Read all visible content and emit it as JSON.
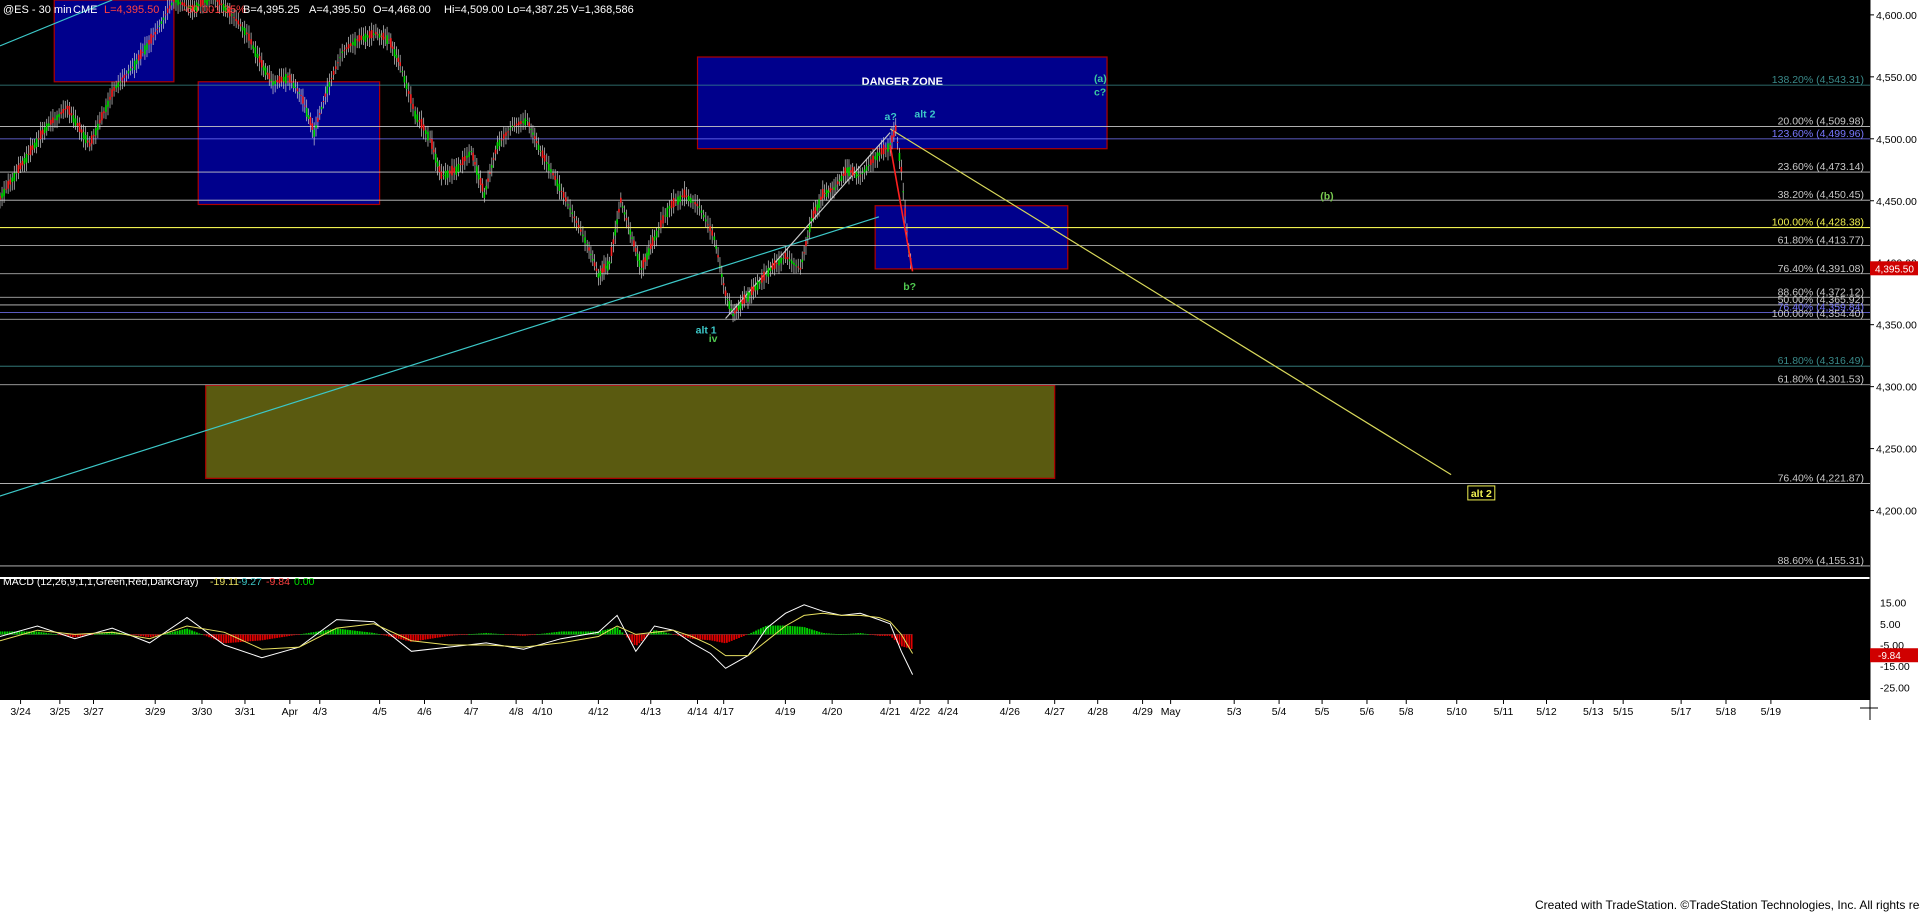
{
  "chart_data": [
    {
      "type": "candlestick",
      "header": {
        "symbol": "@ES - 30 min",
        "exchange": "CME",
        "last": "L=4,395.50",
        "change": "-60.00",
        "change_pct": "-1.35%",
        "bid": "B=4,395.25",
        "ask": "A=4,395.50",
        "open": "O=4,468.00",
        "high": "Hi=4,509.00",
        "low": "Lo=4,387.25",
        "volume": "V=1,368,586"
      },
      "y_axis": {
        "ylim": [
          4148,
          4612
        ],
        "ticks": [
          "4,600.00",
          "4,550.00",
          "4,500.00",
          "4,450.00",
          "4,400.00",
          "4,350.00",
          "4,300.00",
          "4,250.00",
          "4,200.00"
        ],
        "tick_values": [
          4600,
          4550,
          4500,
          4450,
          4400,
          4350,
          4300,
          4250,
          4200
        ],
        "last_price_label": "4,395.50",
        "last_price_value": 4395.5
      },
      "x_axis": {
        "tick_labels": [
          "3/24",
          "3/25",
          "3/27",
          "3/29",
          "3/30",
          "3/31",
          "Apr",
          "4/3",
          "4/5",
          "4/6",
          "4/7",
          "4/8",
          "4/10",
          "4/12",
          "4/13",
          "4/14",
          "4/17",
          "4/19",
          "4/20",
          "4/21",
          "4/22",
          "4/24",
          "4/26",
          "4/27",
          "4/28",
          "4/29",
          "May",
          "5/3",
          "5/4",
          "5/5",
          "5/6",
          "5/8",
          "5/10",
          "5/11",
          "5/12",
          "5/13",
          "5/15",
          "5/17",
          "5/18",
          "5/19"
        ],
        "index_range": [
          0,
          100
        ],
        "tick_positions": [
          1.1,
          3.2,
          5.0,
          8.3,
          10.8,
          13.1,
          15.5,
          17.1,
          20.3,
          22.7,
          25.2,
          27.6,
          29.0,
          32.0,
          34.8,
          37.3,
          38.7,
          42.0,
          44.5,
          47.6,
          49.2,
          50.7,
          54.0,
          56.4,
          58.7,
          61.1,
          62.6,
          66.0,
          68.4,
          70.7,
          73.1,
          75.2,
          77.9,
          80.4,
          82.7,
          85.2,
          86.8,
          89.9,
          92.3,
          94.7
        ]
      },
      "price_path": [
        [
          0.0,
          4452
        ],
        [
          1.2,
          4480
        ],
        [
          2.5,
          4510
        ],
        [
          3.6,
          4525
        ],
        [
          4.8,
          4495
        ],
        [
          6.1,
          4540
        ],
        [
          7.2,
          4560
        ],
        [
          8.3,
          4585
        ],
        [
          9.3,
          4612
        ],
        [
          10.3,
          4605
        ],
        [
          11.4,
          4615
        ],
        [
          12.4,
          4600
        ],
        [
          13.2,
          4585
        ],
        [
          14.0,
          4560
        ],
        [
          14.6,
          4545
        ],
        [
          15.4,
          4550
        ],
        [
          16.1,
          4535
        ],
        [
          16.8,
          4505
        ],
        [
          17.5,
          4540
        ],
        [
          18.3,
          4570
        ],
        [
          19.1,
          4580
        ],
        [
          20.1,
          4585
        ],
        [
          20.8,
          4580
        ],
        [
          21.4,
          4560
        ],
        [
          22.2,
          4520
        ],
        [
          23.0,
          4500
        ],
        [
          23.6,
          4470
        ],
        [
          24.4,
          4475
        ],
        [
          25.2,
          4490
        ],
        [
          25.9,
          4455
        ],
        [
          26.6,
          4495
        ],
        [
          27.4,
          4510
        ],
        [
          28.2,
          4515
        ],
        [
          28.9,
          4490
        ],
        [
          29.8,
          4465
        ],
        [
          30.6,
          4440
        ],
        [
          31.4,
          4415
        ],
        [
          32.0,
          4390
        ],
        [
          32.6,
          4400
        ],
        [
          33.2,
          4450
        ],
        [
          33.8,
          4420
        ],
        [
          34.3,
          4395
        ],
        [
          35.0,
          4420
        ],
        [
          35.8,
          4445
        ],
        [
          36.6,
          4455
        ],
        [
          37.4,
          4445
        ],
        [
          38.2,
          4420
        ],
        [
          38.8,
          4375
        ],
        [
          39.2,
          4358
        ],
        [
          39.8,
          4370
        ],
        [
          40.4,
          4380
        ],
        [
          41.2,
          4395
        ],
        [
          42.0,
          4405
        ],
        [
          42.8,
          4395
        ],
        [
          43.4,
          4435
        ],
        [
          44.0,
          4455
        ],
        [
          44.6,
          4460
        ],
        [
          45.3,
          4475
        ],
        [
          46.0,
          4470
        ],
        [
          46.8,
          4485
        ],
        [
          47.6,
          4495
        ],
        [
          47.9,
          4508
        ],
        [
          48.2,
          4475
        ],
        [
          48.4,
          4440
        ],
        [
          48.6,
          4410
        ],
        [
          48.8,
          4393
        ]
      ],
      "macd": {
        "label": "MACD (12,26,9,1,1,Green,Red,DarkGray)",
        "values_text": [
          "-19.11",
          "-9.27",
          "-9.84",
          "0.00"
        ],
        "ylim": [
          -31,
          21
        ],
        "ticks": [
          "15.00",
          "5.00",
          "-5.00",
          "-15.00",
          "-25.00"
        ],
        "tick_values": [
          15,
          5,
          -5,
          -15,
          -25
        ],
        "last_label": "-9.84",
        "last_value": -9.84,
        "macd_line": [
          [
            0,
            -1
          ],
          [
            2,
            4
          ],
          [
            4,
            -2
          ],
          [
            6,
            3
          ],
          [
            8,
            -4
          ],
          [
            10,
            8
          ],
          [
            12,
            -5
          ],
          [
            14,
            -11
          ],
          [
            16,
            -6
          ],
          [
            18,
            7
          ],
          [
            20,
            6
          ],
          [
            22,
            -8
          ],
          [
            24,
            -6
          ],
          [
            26,
            -4
          ],
          [
            28,
            -7
          ],
          [
            30,
            -2
          ],
          [
            32,
            1
          ],
          [
            33,
            9
          ],
          [
            34,
            -8
          ],
          [
            35,
            4
          ],
          [
            36,
            2
          ],
          [
            37,
            -4
          ],
          [
            38,
            -9
          ],
          [
            38.8,
            -16
          ],
          [
            40,
            -10
          ],
          [
            41,
            3
          ],
          [
            42,
            10
          ],
          [
            43,
            14
          ],
          [
            44,
            11
          ],
          [
            45,
            9
          ],
          [
            46,
            10
          ],
          [
            47,
            7
          ],
          [
            47.6,
            5
          ],
          [
            48.2,
            -8
          ],
          [
            48.8,
            -19
          ]
        ],
        "signal_line": [
          [
            0,
            -3
          ],
          [
            2,
            2
          ],
          [
            4,
            0
          ],
          [
            6,
            1
          ],
          [
            8,
            -2
          ],
          [
            10,
            4
          ],
          [
            12,
            1
          ],
          [
            14,
            -7
          ],
          [
            16,
            -6
          ],
          [
            18,
            3
          ],
          [
            20,
            5
          ],
          [
            22,
            -3
          ],
          [
            24,
            -5
          ],
          [
            26,
            -5
          ],
          [
            28,
            -6
          ],
          [
            30,
            -4
          ],
          [
            32,
            -1
          ],
          [
            33,
            4
          ],
          [
            34,
            0
          ],
          [
            35,
            1
          ],
          [
            36,
            2
          ],
          [
            37,
            -1
          ],
          [
            38,
            -5
          ],
          [
            38.8,
            -10
          ],
          [
            40,
            -10
          ],
          [
            41,
            -3
          ],
          [
            42,
            4
          ],
          [
            43,
            9
          ],
          [
            44,
            10
          ],
          [
            45,
            9
          ],
          [
            46,
            9
          ],
          [
            47,
            8
          ],
          [
            47.6,
            6
          ],
          [
            48.2,
            0
          ],
          [
            48.8,
            -9
          ]
        ]
      },
      "fib_levels": [
        {
          "label": "138.20% (4,543.31)",
          "value": 4543.31,
          "color": "#3a8a8a"
        },
        {
          "label": "20.00% (4,509.98)",
          "value": 4509.98,
          "color": "#c8c8c8"
        },
        {
          "label": "123.60% (4,499.96)",
          "value": 4499.96,
          "color": "#7878ff"
        },
        {
          "label": "23.60% (4,473.14)",
          "value": 4473.14,
          "color": "#c8c8c8"
        },
        {
          "label": "38.20% (4,450.45)",
          "value": 4450.45,
          "color": "#c8c8c8"
        },
        {
          "label": "100.00% (4,428.38)",
          "value": 4428.38,
          "color": "#f0f050"
        },
        {
          "label": "61.80% (4,413.77)",
          "value": 4413.77,
          "color": "#c8c8c8"
        },
        {
          "label": "76.40% (4,391.08)",
          "value": 4391.08,
          "color": "#c8c8c8"
        },
        {
          "label": "88.60% (4,372.12)",
          "value": 4372.12,
          "color": "#c8c8c8"
        },
        {
          "label": "50.00% (4,365.92)",
          "value": 4365.92,
          "color": "#c8c8c8"
        },
        {
          "label": "76.40% (4,359.84)",
          "value": 4359.84,
          "color": "#7878ff"
        },
        {
          "label": "100.00% (4,354.40)",
          "value": 4354.4,
          "color": "#c8c8c8"
        },
        {
          "label": "61.80% (4,316.49)",
          "value": 4316.49,
          "color": "#3a8a8a"
        },
        {
          "label": "61.80% (4,301.53)",
          "value": 4301.53,
          "color": "#c8c8c8"
        },
        {
          "label": "76.40% (4,221.87)",
          "value": 4221.87,
          "color": "#c8c8c8"
        },
        {
          "label": "88.60% (4,155.31)",
          "value": 4155.31,
          "color": "#c8c8c8"
        }
      ],
      "zones": [
        {
          "name": "",
          "x0": 2.9,
          "x1": 9.3,
          "y0": 4546,
          "y1": 4612,
          "fill": "#00008c",
          "stroke": "#b00000"
        },
        {
          "name": "",
          "x0": 10.6,
          "x1": 20.3,
          "y0": 4447,
          "y1": 4546,
          "fill": "#00008c",
          "stroke": "#b00000"
        },
        {
          "name": "DANGER ZONE",
          "x0": 37.3,
          "x1": 59.2,
          "y0": 4492,
          "y1": 4566,
          "fill": "#00008c",
          "stroke": "#b00000"
        },
        {
          "name": "",
          "x0": 46.8,
          "x1": 57.1,
          "y0": 4395,
          "y1": 4446,
          "fill": "#00008c",
          "stroke": "#b00000"
        },
        {
          "name": "",
          "x0": 11.0,
          "x1": 56.4,
          "y0": 4226,
          "y1": 4301,
          "fill": "#5a5a10",
          "stroke": "#b00000"
        }
      ],
      "trendlines": [
        {
          "from": [
            -1,
            4207
          ],
          "to": [
            47.0,
            4437
          ],
          "color": "#3cc8c8"
        },
        {
          "from": [
            0,
            4575
          ],
          "to": [
            6.0,
            4612
          ],
          "color": "#3cc8c8"
        },
        {
          "from": [
            38.8,
            4355
          ],
          "to": [
            47.6,
            4505
          ],
          "color": "#c8c8c8"
        },
        {
          "from": [
            47.6,
            4508
          ],
          "to": [
            77.6,
            4229
          ],
          "color": "#d8d85a"
        }
      ],
      "annotations": [
        {
          "text": "a?",
          "x": 47.3,
          "y": 4515,
          "color": "#3cc8c8"
        },
        {
          "text": "alt 2",
          "x": 48.9,
          "y": 4517,
          "color": "#3cc8c8"
        },
        {
          "text": "(a)",
          "x": 58.5,
          "y": 4546,
          "color": "#3cc8a0"
        },
        {
          "text": "c?",
          "x": 58.5,
          "y": 4535,
          "color": "#3cc8a0"
        },
        {
          "text": "(b)",
          "x": 70.6,
          "y": 4451,
          "color": "#78c850"
        },
        {
          "text": "b?",
          "x": 48.3,
          "y": 4378,
          "color": "#50c850"
        },
        {
          "text": "alt 1",
          "x": 37.2,
          "y": 4343,
          "color": "#3cc8c8"
        },
        {
          "text": "iv",
          "x": 37.9,
          "y": 4336,
          "color": "#50c850"
        }
      ],
      "boxed_label": {
        "text": "alt 2",
        "x": 78.6,
        "y": 4211
      }
    }
  ],
  "footer": {
    "credit": "Created with TradeStation. ©TradeStation Technologies, Inc. All rights reserved."
  }
}
